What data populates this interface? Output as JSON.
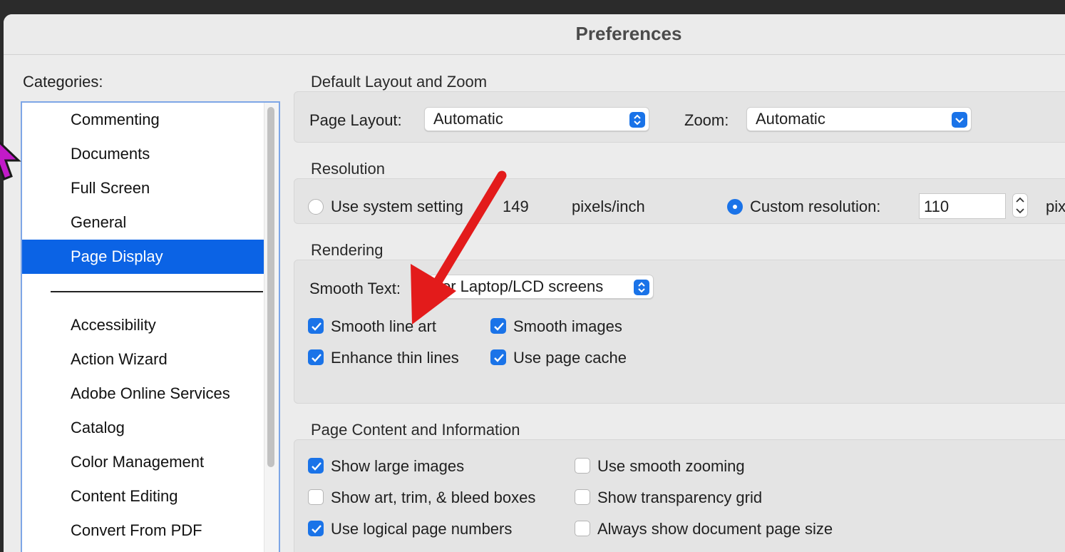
{
  "window": {
    "title": "Preferences"
  },
  "categories": {
    "label": "Categories:",
    "items": [
      {
        "label": "Commenting",
        "selected": false
      },
      {
        "label": "Documents",
        "selected": false
      },
      {
        "label": "Full Screen",
        "selected": false
      },
      {
        "label": "General",
        "selected": false
      },
      {
        "label": "Page Display",
        "selected": true
      }
    ],
    "more_items": [
      {
        "label": "Accessibility"
      },
      {
        "label": "Action Wizard"
      },
      {
        "label": "Adobe Online Services"
      },
      {
        "label": "Catalog"
      },
      {
        "label": "Color Management"
      },
      {
        "label": "Content Editing"
      },
      {
        "label": "Convert From PDF"
      }
    ]
  },
  "layout_zoom": {
    "title": "Default Layout and Zoom",
    "page_layout_label": "Page Layout:",
    "page_layout_value": "Automatic",
    "zoom_label": "Zoom:",
    "zoom_value": "Automatic"
  },
  "resolution": {
    "title": "Resolution",
    "system_label": "Use system setting",
    "system_value": "149",
    "system_unit": "pixels/inch",
    "custom_label": "Custom resolution:",
    "custom_value": "110",
    "custom_unit": "pix",
    "selected": "custom"
  },
  "rendering": {
    "title": "Rendering",
    "smooth_text_label": "Smooth Text:",
    "smooth_text_value": "or Laptop/LCD screens",
    "checks": {
      "smooth_line_art": {
        "label": "Smooth line art",
        "checked": true
      },
      "smooth_images": {
        "label": "Smooth images",
        "checked": true
      },
      "enhance_thin_lines": {
        "label": "Enhance thin lines",
        "checked": true
      },
      "use_page_cache": {
        "label": "Use page cache",
        "checked": true
      }
    }
  },
  "page_content": {
    "title": "Page Content and Information",
    "checks": {
      "show_large_images": {
        "label": "Show large images",
        "checked": true
      },
      "use_smooth_zooming": {
        "label": "Use smooth zooming",
        "checked": false
      },
      "show_art_trim_bleed": {
        "label": "Show art, trim, & bleed boxes",
        "checked": false
      },
      "show_transparency_grid": {
        "label": "Show transparency grid",
        "checked": false
      },
      "use_logical_page_numbers": {
        "label": "Use logical page numbers",
        "checked": true
      },
      "always_show_page_size": {
        "label": "Always show document page size",
        "checked": false
      }
    }
  },
  "colors": {
    "accent": "#1a73e8",
    "selection": "#0b63e5",
    "annotation_arrow": "#e31b1b",
    "cursor": "#c21ac8"
  },
  "icons": {
    "cursor": "mouse-pointer-icon",
    "annotation": "red-arrow-icon",
    "popup": "up-down-chevron-icon",
    "dropdown": "chevron-down-icon",
    "check": "checkmark-icon"
  }
}
